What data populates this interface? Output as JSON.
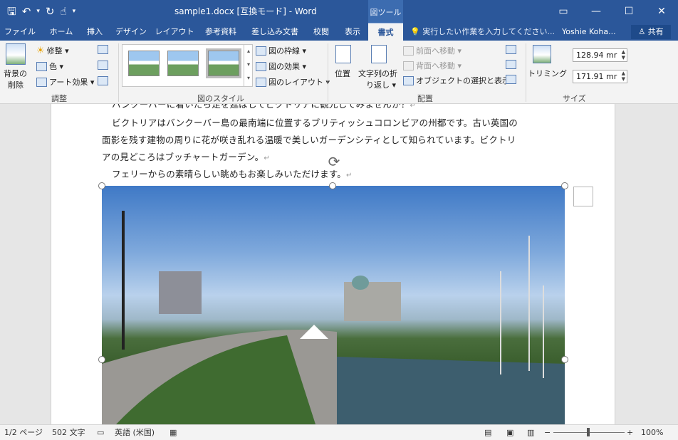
{
  "window": {
    "title": "sample1.docx [互換モード] - Word",
    "context_tools": "図ツール",
    "controls": [
      "▭",
      "—",
      "☐",
      "✕"
    ]
  },
  "qat": {
    "save": "🖫",
    "undo": "↶",
    "redo": "↻",
    "touch": "☝",
    "more": "▾"
  },
  "tabs": [
    "ファイル",
    "ホーム",
    "挿入",
    "デザイン",
    "レイアウト",
    "参考資料",
    "差し込み文書",
    "校閲",
    "表示",
    "書式"
  ],
  "tellme": "💡 実行したい作業を入力してください...",
  "user": "Yoshie Koha...",
  "share": "♙ 共有",
  "ribbon": {
    "adjust": {
      "remove_bg": [
        "背景の",
        "削除"
      ],
      "corrections": "修整 ▾",
      "color": "色 ▾",
      "artistic": "アート効果 ▾",
      "label": "調整"
    },
    "styles": {
      "border": "図の枠線 ▾",
      "effects": "図の効果 ▾",
      "layout": "図のレイアウト ▾",
      "label": "図のスタイル"
    },
    "arrange": {
      "position": "位置",
      "wrap": [
        "文字列の折",
        "り返し ▾"
      ],
      "bring_forward": "前面へ移動 ▾",
      "send_backward": "背面へ移動 ▾",
      "selection_pane": "オブジェクトの選択と表示",
      "label": "配置"
    },
    "size": {
      "crop": "トリミング",
      "height": "128.94 mr",
      "width": "171.91 mr",
      "label": "サイズ"
    }
  },
  "document": {
    "lines": [
      "バンクーバーに着いたら足を延ばしてビクトリアに観光してみませんか？",
      "ビクトリアはバンクーバー島の最南端に位置するブリティッシュコロンビアの州都です。古い英国の",
      "面影を残す建物の周りに花が咲き乱れる温暖で美しいガーデンシティとして知られています。ビクトリ",
      "アの見どころはブッチャートガーデン。",
      "フェリーからの素晴らしい眺めもお楽しみいただけます。"
    ],
    "para_mark": "↵"
  },
  "status": {
    "page": "1/2 ページ",
    "words": "502 文字",
    "lang": "英語 (米国)",
    "zoom": "100%"
  }
}
